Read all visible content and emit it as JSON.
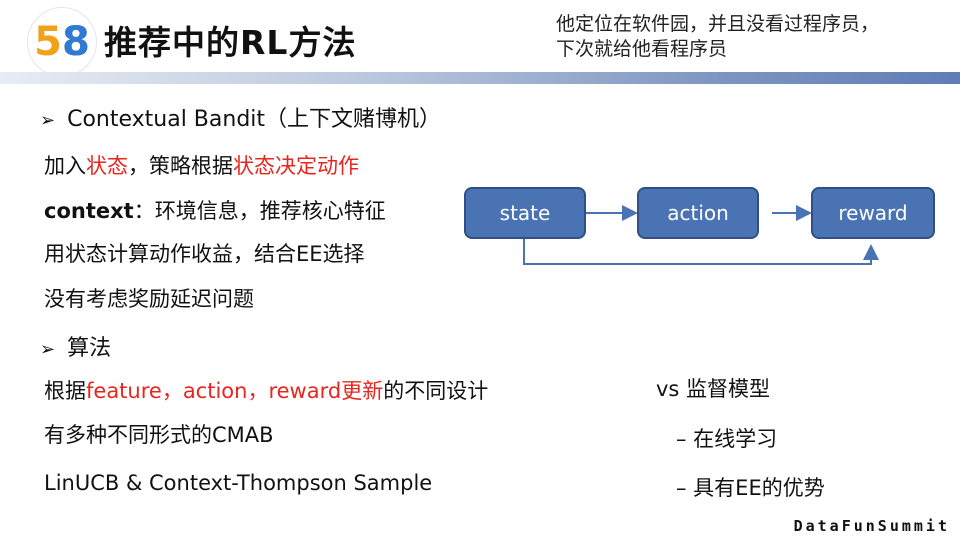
{
  "header": {
    "logo_text": "58",
    "title": "推荐中的RL方法",
    "note_line1": "他定位在软件园，并且没看过程序员，",
    "note_line2": "下次就给他看程序员"
  },
  "section1": {
    "heading": "Contextual Bandit（上下文赌博机）",
    "line1_a": "加入",
    "line1_b": "状态",
    "line1_c": "，策略根据",
    "line1_d": "状态决定动作",
    "line2_a": "context",
    "line2_b": "：环境信息，推荐核心特征",
    "line3": "用状态计算动作收益，结合EE选择",
    "line4": "没有考虑奖励延迟问题"
  },
  "flow": {
    "state": "state",
    "action": "action",
    "reward": "reward"
  },
  "section2": {
    "heading": "算法",
    "line1_a": "根据",
    "line1_b": "feature，action，reward更新",
    "line1_c": "的不同设计",
    "line2": "有多种不同形式的CMAB",
    "line3": "LinUCB & Context-Thompson Sample",
    "vs_title": "vs 监督模型",
    "vs_item1": "–  在线学习",
    "vs_item2": "–  具有EE的优势"
  },
  "footer": {
    "brand": "DataFunSummit"
  },
  "colors": {
    "accent_red": "#e8261f",
    "box_fill": "#4a73b4",
    "box_border": "#2f4f86",
    "logo_5": "#f0a31a",
    "logo_8a": "#2e7bd6",
    "logo_8b": "#e83b2f"
  }
}
